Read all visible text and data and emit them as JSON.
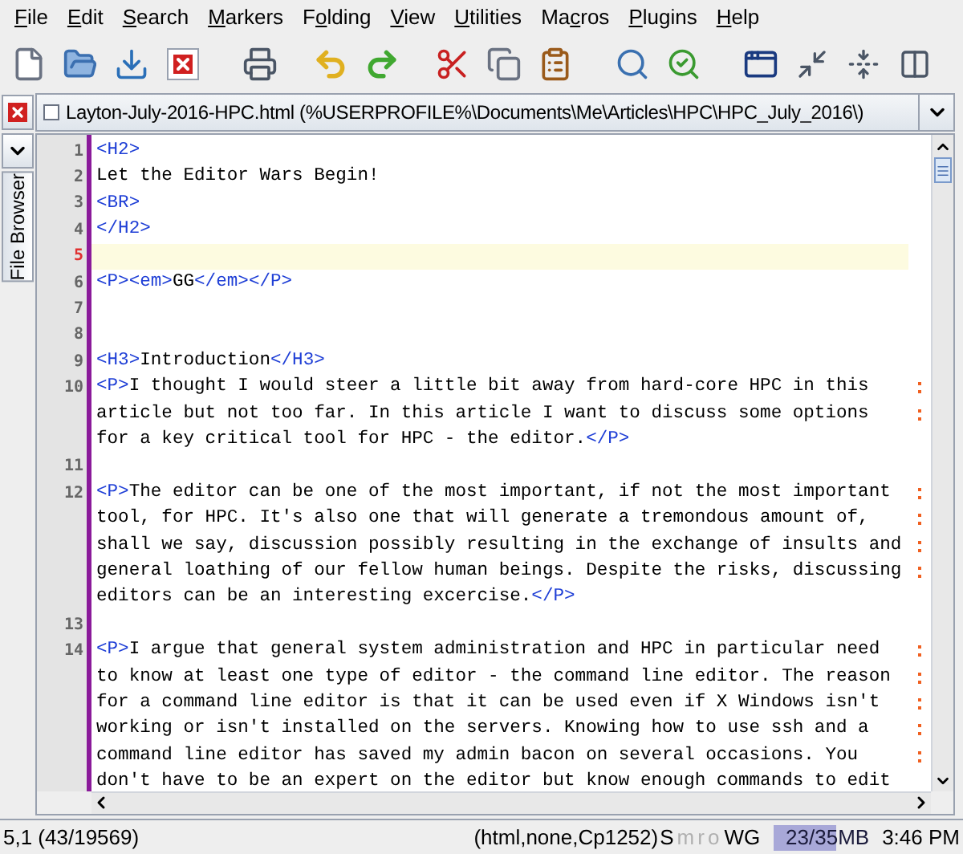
{
  "menu": [
    {
      "key": "F",
      "after": "ile"
    },
    {
      "key": "E",
      "after": "dit"
    },
    {
      "key": "S",
      "after": "earch"
    },
    {
      "key": "M",
      "after": "arkers"
    },
    {
      "before": "F",
      "key": "o",
      "after": "lding"
    },
    {
      "key": "V",
      "after": "iew"
    },
    {
      "key": "U",
      "after": "tilities"
    },
    {
      "before": "Ma",
      "key": "c",
      "after": "ros"
    },
    {
      "key": "P",
      "after": "lugins"
    },
    {
      "key": "H",
      "after": "elp"
    }
  ],
  "tab": {
    "title": "Layton-July-2016-HPC.html (%USERPROFILE%\\Documents\\Me\\Articles\\HPC\\HPC_July_2016\\)"
  },
  "side_panel": {
    "label": "File Browser"
  },
  "lines": [
    {
      "number": "1",
      "selected": false,
      "rows": [
        "<H2>"
      ]
    },
    {
      "number": "2",
      "selected": false,
      "rows": [
        "Let the Editor Wars Begin!"
      ]
    },
    {
      "number": "3",
      "selected": false,
      "rows": [
        "<BR>"
      ]
    },
    {
      "number": "4",
      "selected": false,
      "rows": [
        "</H2>"
      ]
    },
    {
      "number": "5",
      "selected": true
    },
    {
      "number": "6",
      "selected": false,
      "rows": [
        "<P><em>GG</em></P>"
      ]
    },
    {
      "number": "7",
      "selected": false
    },
    {
      "number": "8",
      "selected": false
    },
    {
      "number": "9",
      "selected": false,
      "rows": [
        "<H3>Introduction</H3>"
      ]
    },
    {
      "number": "10",
      "selected": false,
      "rows": [
        "<P>I thought I would steer a little bit away from hard-core HPC in this",
        "article but not too far. In this article I want to discuss some options",
        "for a key critical tool for HPC - the editor.</P>"
      ]
    },
    {
      "number": "11",
      "selected": false
    },
    {
      "number": "12",
      "selected": false,
      "rows": [
        "<P>The editor can be one of the most important, if not the most important",
        "tool, for HPC. It's also one that will generate a tremondous amount of,",
        "shall we say, discussion possibly resulting in the exchange of insults and",
        "general loathing of our fellow human beings. Despite the risks, discussing",
        "editors can be an interesting excercise.</P>"
      ]
    },
    {
      "number": "13",
      "selected": false
    },
    {
      "number": "14",
      "selected": false,
      "rows": [
        "<P>I argue that general system administration and HPC in particular need",
        "to know at least one type of editor - the command line editor. The reason",
        "for a command line editor is that it can be used even if X Windows isn't",
        "working or isn't installed on the servers. Knowing how to use ssh and a",
        "command line editor has saved my admin bacon on several occasions. You",
        "don't have to be an expert on the editor but know enough commands to edit"
      ]
    }
  ],
  "status_bar": {
    "position": "5,1 (43/19569)",
    "mode": "(html,none,Cp1252)",
    "flags": [
      {
        "label": "S",
        "on": true
      },
      {
        "label": "m",
        "on": false
      },
      {
        "label": "r",
        "on": false
      },
      {
        "label": "o",
        "on": false
      }
    ],
    "encoding_flags": "WG",
    "memory": {
      "reading": "23/35MB",
      "level": 0.66
    },
    "time": "3:46 PM"
  }
}
